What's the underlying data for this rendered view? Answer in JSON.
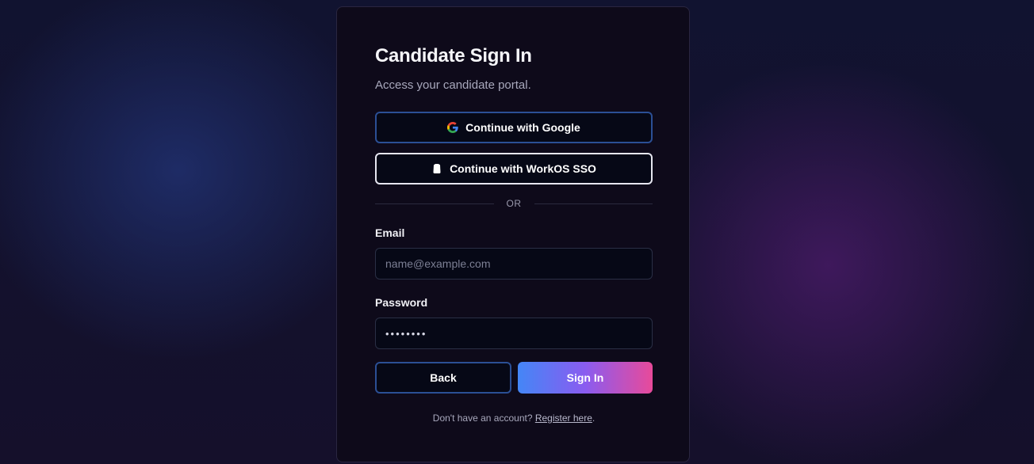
{
  "signin": {
    "title": "Candidate Sign In",
    "subtitle": "Access your candidate portal.",
    "google_button": "Continue with Google",
    "sso_button": "Continue with WorkOS SSO",
    "divider": "OR",
    "email_label": "Email",
    "email_placeholder": "name@example.com",
    "email_value": "",
    "password_label": "Password",
    "password_value": "password",
    "back_button": "Back",
    "signin_button": "Sign In",
    "footer_text": "Don't have an account? ",
    "footer_link": "Register here",
    "footer_end": "."
  },
  "icons": {
    "google": "google-icon",
    "sso": "shield-icon"
  },
  "colors": {
    "gradient_start": "#4486f6",
    "gradient_end": "#e84a9a",
    "google_border": "#2b4f95",
    "sso_border": "#e6e6f0"
  }
}
